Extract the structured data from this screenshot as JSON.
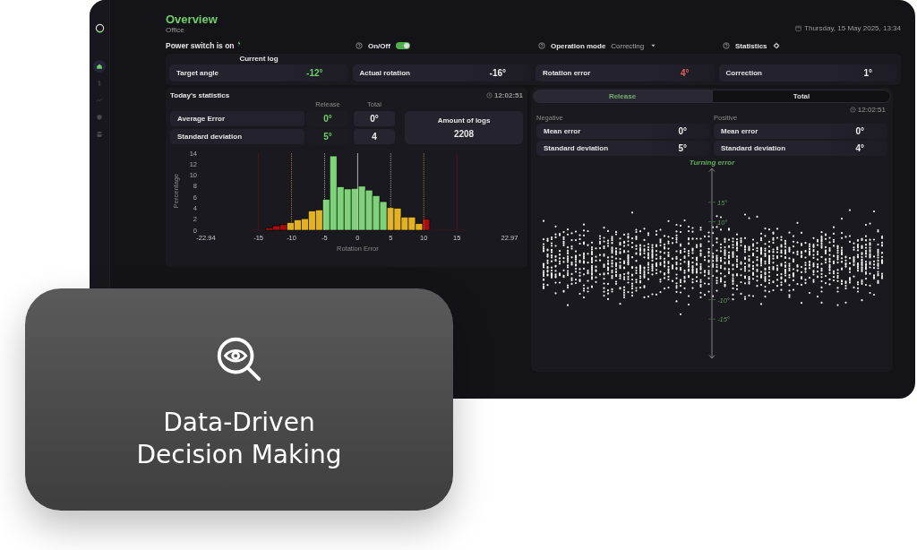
{
  "sidebar": {
    "items": [
      {
        "kind": "home",
        "selected": true
      },
      {
        "kind": "dollar",
        "selected": false
      },
      {
        "kind": "trend",
        "selected": false
      },
      {
        "kind": "shield",
        "selected": false
      },
      {
        "kind": "database",
        "selected": false
      }
    ]
  },
  "header": {
    "title": "Overview",
    "subtitle": "Office",
    "datetime": "Thursday, 15 May 2025, 13:34"
  },
  "toolbar": {
    "power_status": "Power switch is on",
    "switch_label": "On/Off",
    "switch_on": true,
    "mode_label": "Operation mode",
    "mode_value": "Correcting",
    "statistics_label": "Statistics"
  },
  "current_log": {
    "title": "Current log",
    "items": [
      {
        "label": "Target angle",
        "value": "-12°",
        "color": "#6fcf6a"
      },
      {
        "label": "Actual rotation",
        "value": "-16°",
        "color": "#eeeeee"
      },
      {
        "label": "Rotation error",
        "value": "4°",
        "color": "#e06060"
      },
      {
        "label": "Correction",
        "value": "1°",
        "color": "#eeeeee"
      }
    ]
  },
  "today": {
    "title": "Today's statistics",
    "time": "12:02:51",
    "columns": [
      "Release",
      "Total"
    ],
    "rows": [
      {
        "label": "Average Error",
        "release": "0°",
        "total": "0°"
      },
      {
        "label": "Standard deviation",
        "release": "5°",
        "total": "4"
      }
    ],
    "logs_label": "Amount of logs",
    "logs_value": "2208",
    "chart_data": {
      "type": "bar",
      "grid": true,
      "xlabel": "Rotation Error",
      "ylabel": "Percentage",
      "x": [
        -13.4,
        -12.32,
        -11.24,
        -10.16,
        -9.08,
        -8.0,
        -6.92,
        -5.84,
        -4.76,
        -3.68,
        -2.6,
        -1.52,
        -0.44,
        0.64,
        1.72,
        2.8,
        3.88,
        4.96,
        6.04,
        7.12,
        8.2,
        9.28,
        10.36
      ],
      "series": [
        {
          "color": "#a50f0f",
          "values": [
            0.4,
            0.8,
            1.0,
            null,
            null,
            null,
            null,
            null,
            null,
            null,
            null,
            null,
            null,
            null,
            null,
            null,
            null,
            null,
            null,
            null,
            null,
            null,
            2.0
          ]
        },
        {
          "color": "#e2b224",
          "values": [
            null,
            null,
            null,
            1.4,
            1.9,
            2.1,
            3.5,
            3.7,
            null,
            null,
            null,
            null,
            null,
            null,
            null,
            null,
            null,
            4.1,
            4.0,
            2.4,
            2.4,
            1.2,
            null
          ]
        },
        {
          "color": "#7fd27a",
          "values": [
            null,
            null,
            null,
            null,
            null,
            null,
            null,
            null,
            5.6,
            13.5,
            7.9,
            7.5,
            7.6,
            8.0,
            7.3,
            6.3,
            5.2,
            null,
            null,
            null,
            null,
            null,
            null
          ]
        }
      ],
      "xlim": [
        -22.94,
        22.97
      ],
      "ylim": [
        0,
        14
      ],
      "xticks": [
        {
          "value": -22.94,
          "label": "-22.94"
        },
        -15,
        -10,
        -5,
        0,
        5,
        10,
        15,
        {
          "value": 22.97,
          "label": "22.97"
        }
      ],
      "yticks": [
        0,
        2,
        4,
        6,
        8,
        10,
        12,
        14
      ]
    }
  },
  "distribution": {
    "tabs": [
      {
        "label": "Release",
        "selected": true
      },
      {
        "label": "Total",
        "selected": false
      }
    ],
    "time": "12:02:51",
    "groups": [
      {
        "title": "Negative",
        "rows": [
          {
            "label": "Mean error",
            "value": "0°"
          },
          {
            "label": "Standard deviation",
            "value": "5°"
          }
        ]
      },
      {
        "title": "Positive",
        "rows": [
          {
            "label": "Mean error",
            "value": "0°"
          },
          {
            "label": "Standard deviation",
            "value": "4°"
          }
        ]
      }
    ],
    "plot": {
      "axis_label": "Turning error",
      "ticks": [
        "15°",
        "10°",
        "-10°",
        "-15°"
      ]
    }
  },
  "feature_card": {
    "title": "Data-Driven Decision Making"
  }
}
